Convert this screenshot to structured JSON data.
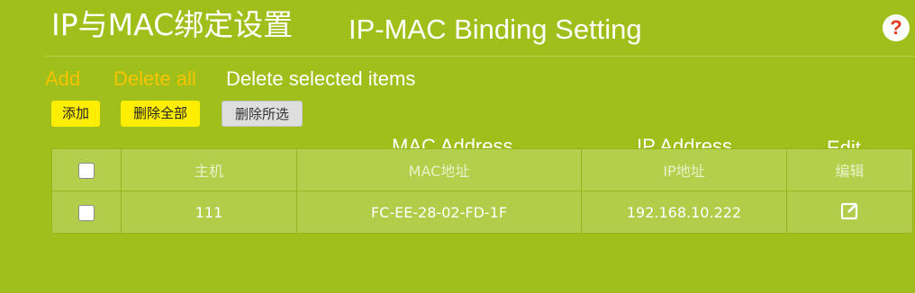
{
  "header": {
    "title_cn": "IP与MAC绑定设置",
    "title_en": "IP-MAC Binding Setting",
    "help_icon": "?"
  },
  "annotations": {
    "add": "Add",
    "delete_all": "Delete all",
    "delete_selected": "Delete selected items",
    "mac_address": "MAC Address",
    "ip_address": "IP Address",
    "edit": "Edit"
  },
  "toolbar": {
    "add_label": "添加",
    "delete_all_label": "删除全部",
    "delete_selected_label": "删除所选"
  },
  "table": {
    "columns": [
      "",
      "主机",
      "MAC地址",
      "IP地址",
      "编辑"
    ],
    "rows": [
      {
        "host": "111",
        "mac": "FC-EE-28-02-FD-1F",
        "ip": "192.168.10.222",
        "checked": false
      }
    ]
  },
  "colors": {
    "background": "#a0bf1a",
    "button_yellow": "#ffee00",
    "annotation_orange": "#f6c400",
    "help_icon_red": "#e0391e"
  },
  "icons": {
    "help": "help-icon",
    "edit": "edit-icon"
  }
}
